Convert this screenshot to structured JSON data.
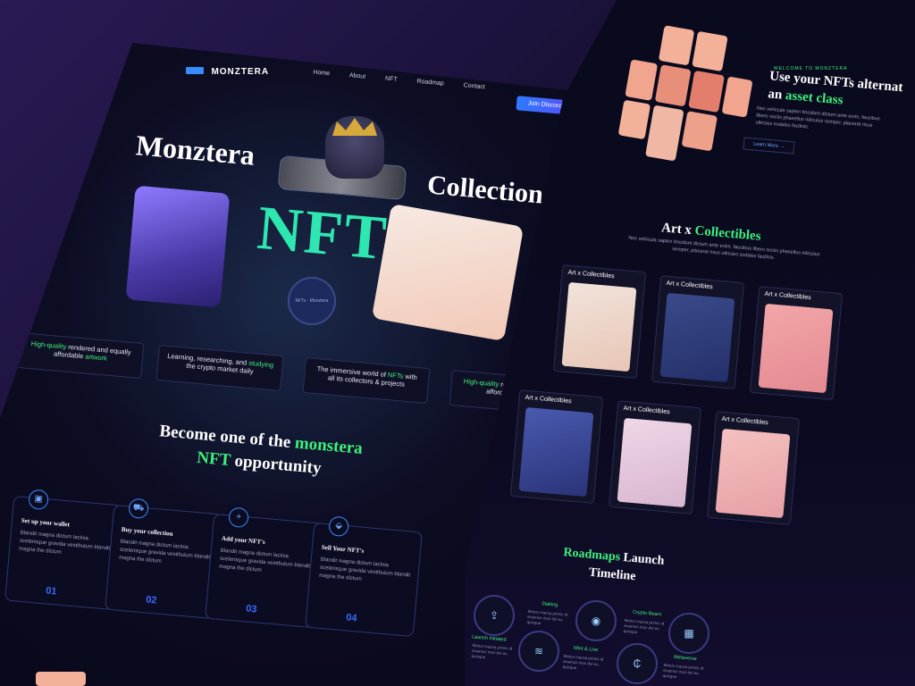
{
  "brand": {
    "name": "MONZTERA"
  },
  "nav": {
    "items": [
      "Home",
      "About",
      "NFT",
      "Roadmap",
      "Contact"
    ],
    "cta": "Join Discord"
  },
  "hero": {
    "title_left": "Monztera",
    "title_right": "Collection",
    "title_big": "NFT",
    "seal_text": "NFTs · Monztera"
  },
  "features": [
    {
      "pre": "High-quality",
      "text": " rendered and equally affordable ",
      "post": "artwork"
    },
    {
      "pre": "Learning, researching, and ",
      "text": "studying",
      "post": " the crypto market daily"
    },
    {
      "pre": "The immersive world of ",
      "text": "NFTs",
      "post": " with all its collectors & projects"
    },
    {
      "pre": "High-quality",
      "text": " rendered and equally affordable ",
      "post": "artwork"
    }
  ],
  "become": {
    "line1": "Become one of the ",
    "green1": "monstera",
    "green2": "NFT",
    "line2": " opportunity"
  },
  "steps": [
    {
      "title": "Set up your wallet",
      "body": "Blandit magna dictum lacinia scelerisque gravida vestibulum blandit magna the dictum",
      "num": "01",
      "icon": "wallet-icon"
    },
    {
      "title": "Buy your collection",
      "body": "Blandit magna dictum lacinia scelerisque gravida vestibulum blandit magna the dictum",
      "num": "02",
      "icon": "cart-icon"
    },
    {
      "title": "Add your NFT's",
      "body": "Blandit magna dictum lacinia scelerisque gravida vestibulum blandit magna the dictum",
      "num": "03",
      "icon": "plus-icon"
    },
    {
      "title": "Sell Your NFT's",
      "body": "Blandit magna dictum lacinia scelerisque gravida vestibulum blandit magna the dictum",
      "num": "04",
      "icon": "tag-icon"
    }
  ],
  "about": {
    "welcome": "WELCOME TO MONZTERA",
    "title_a": "Use your NFTs alternat",
    "title_b": "an ",
    "title_green": "asset class",
    "body": "Nec vehicula sapien tincidunt dictum ante enim, faucibus libero sociis phasellus ridiculus semper, placerat risus ultricies sodales facilisis.",
    "cta": "Learn More →"
  },
  "collectibles": {
    "title_a": "Art x ",
    "title_green": "Collectibles",
    "body": "Nec vehicula sapien tincidunt dictum ante enim, faucibus libero sociis phasellus ridiculus semper, placerat risus ultricies sodales facilisis.",
    "card_label": "Art x Collectibles"
  },
  "roadmap": {
    "title_green": "Roadmaps",
    "title_a": " Launch",
    "title_b": "Timeline",
    "nodes": [
      {
        "label": "Launch initiated",
        "icon": "rocket-icon"
      },
      {
        "label": "Staking",
        "icon": "layers-icon"
      },
      {
        "label": "Mint & Live",
        "icon": "signal-icon"
      },
      {
        "label": "Crypto Bears",
        "icon": "coin-icon"
      },
      {
        "label": "Metaverse",
        "icon": "chart-icon"
      }
    ],
    "node_body": "Metus massa primis id vivamus mus dui eu quisque"
  },
  "colors": {
    "accent_green": "#3df07a",
    "accent_blue": "#2d7bff",
    "nft_teal": "#2ee6b0",
    "peach": "#f3b19a"
  }
}
